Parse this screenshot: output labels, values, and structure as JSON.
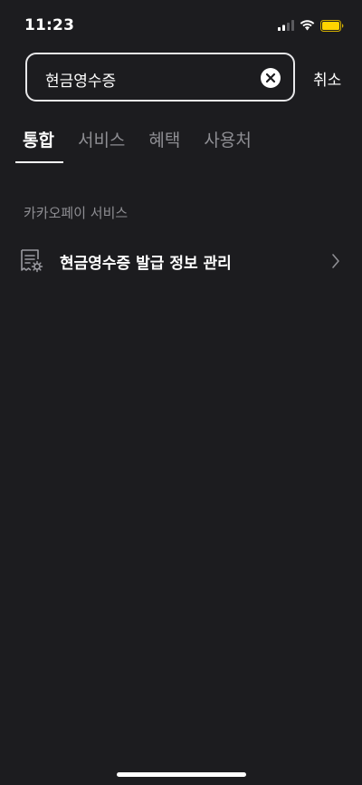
{
  "status_bar": {
    "time": "11:23"
  },
  "search": {
    "query": "현금영수증",
    "cancel_label": "취소"
  },
  "tabs": [
    {
      "label": "통합",
      "active": true
    },
    {
      "label": "서비스",
      "active": false
    },
    {
      "label": "혜택",
      "active": false
    },
    {
      "label": "사용처",
      "active": false
    }
  ],
  "results": {
    "section_title": "카카오페이 서비스",
    "items": [
      {
        "label": "현금영수증 발급 정보 관리",
        "icon": "receipt-settings-icon"
      }
    ]
  },
  "colors": {
    "background": "#1c1c1f",
    "text_primary": "#ffffff",
    "text_secondary": "#8e8e93",
    "battery": "#ffd400"
  }
}
